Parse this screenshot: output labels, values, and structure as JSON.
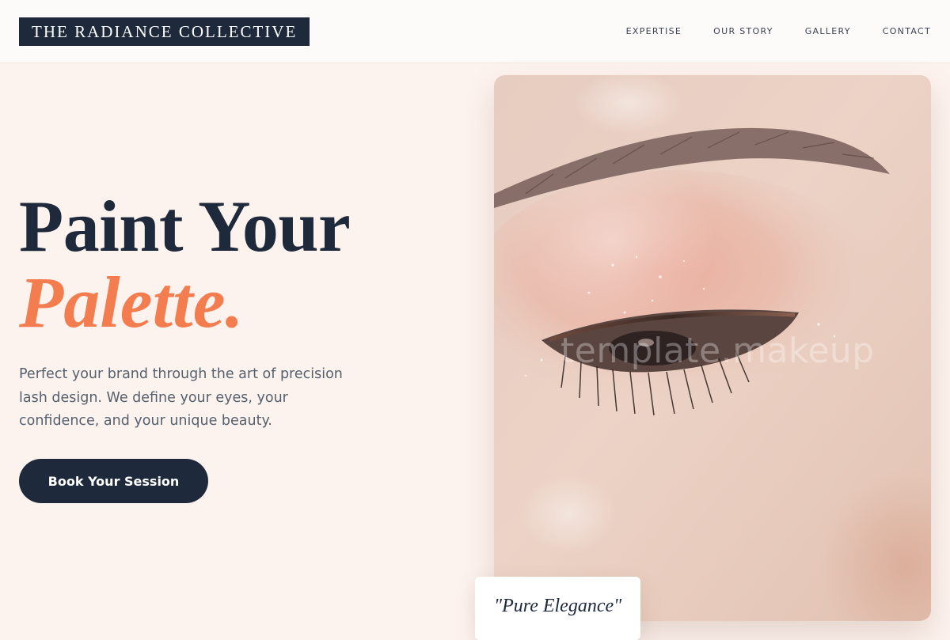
{
  "header": {
    "logo": "THE RADIANCE COLLECTIVE",
    "nav": [
      "EXPERTISE",
      "OUR STORY",
      "GALLERY",
      "CONTACT"
    ]
  },
  "hero": {
    "title_line1": "Paint Your",
    "title_line2": "Palette.",
    "description": "Perfect your brand through the art of precision lash design. We define your eyes, your confidence, and your unique beauty.",
    "cta_label": "Book Your Session"
  },
  "photo": {
    "subject": "close-up-eye-makeup-photo",
    "watermark": "template.makeup"
  },
  "quote": {
    "text": "\"Pure Elegance\""
  },
  "colors": {
    "navy": "#1e293b",
    "accent": "#f47d50",
    "background": "#fdf3ee",
    "header_bg": "#fdfbf9",
    "body_text": "#55606e"
  }
}
